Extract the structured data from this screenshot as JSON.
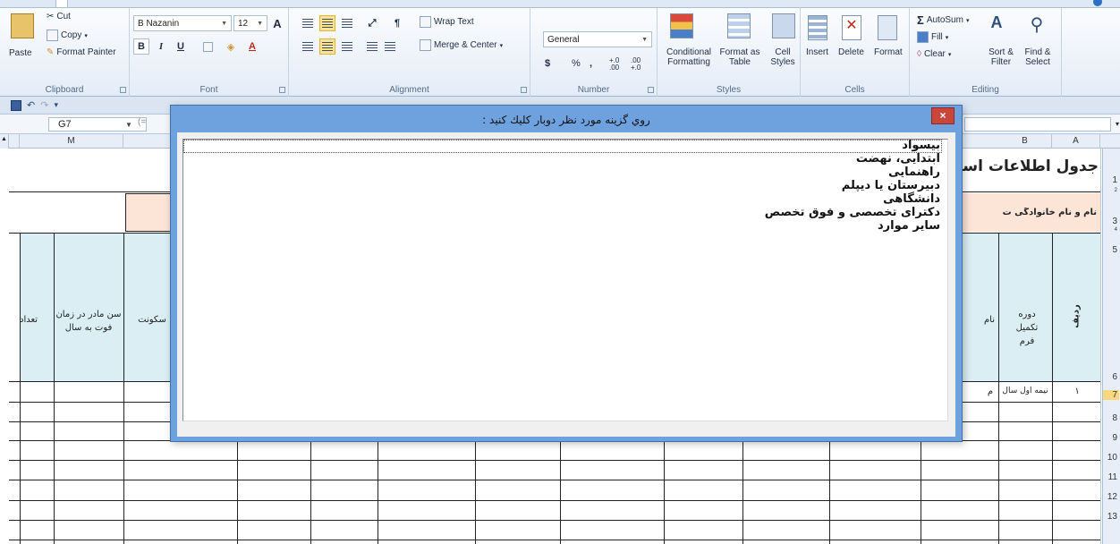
{
  "ribbon": {
    "clipboard": {
      "label": "Clipboard",
      "paste": "Paste",
      "cut": "Cut",
      "copy": "Copy",
      "format_painter": "Format Painter"
    },
    "font": {
      "label": "Font",
      "name": "B Nazanin",
      "size": "12",
      "bold": "B",
      "italic": "I",
      "underline": "U"
    },
    "alignment": {
      "label": "Alignment",
      "wrap_text": "Wrap Text",
      "merge_center": "Merge & Center"
    },
    "number": {
      "label": "Number",
      "format": "General",
      "currency": "$",
      "percent": "%",
      "comma": ",",
      "inc_decimal": "+.0 .00",
      "dec_decimal": ".00 +.0"
    },
    "styles": {
      "label": "Styles",
      "conditional": "Conditional Formatting",
      "format_table": "Format as Table",
      "cell_styles": "Cell Styles"
    },
    "cells": {
      "label": "Cells",
      "insert": "Insert",
      "delete": "Delete",
      "format": "Format"
    },
    "editing": {
      "label": "Editing",
      "autosum": "AutoSum",
      "fill": "Fill",
      "clear": "Clear",
      "sort_filter": "Sort & Filter",
      "find_select": "Find & Select"
    }
  },
  "formula_bar": {
    "name_box": "G7",
    "fx": "(="
  },
  "columns": {
    "m": "M",
    "b": "B",
    "a": "A"
  },
  "rows": [
    "1",
    "2",
    "3",
    "4",
    "5",
    "6",
    "7",
    "8",
    "9",
    "10",
    "11",
    "12",
    "13"
  ],
  "selected_row": "7",
  "sheet": {
    "title": "جدول اطلاعات استخ",
    "name_label": "نام و نام خانوادگی ت",
    "col_mother_age": "سن مادر در زمان فوت به سال",
    "col_count": "تعداد",
    "col_residence": "سکونت",
    "col_name_partial": "نام",
    "col_period": "دوره تکمیل فرم",
    "col_row": "ردیف",
    "row1_period": "نیمه اول سال",
    "row1_index": "۱",
    "row1_partial": "م"
  },
  "dialog": {
    "title": "روي گزينه مورد نظر دوبار كليك كنيد :",
    "close": "×",
    "items": [
      "بیسواد",
      "ابتدایی، نهضت",
      "راهنمایی",
      "دبیرستان یا دیپلم",
      "دانشگاهی",
      "دکترای تخصصی و فوق تخصص",
      "سایر موارد"
    ]
  },
  "icons": {
    "undo": "↶",
    "redo": "↷",
    "sigma": "Σ"
  }
}
